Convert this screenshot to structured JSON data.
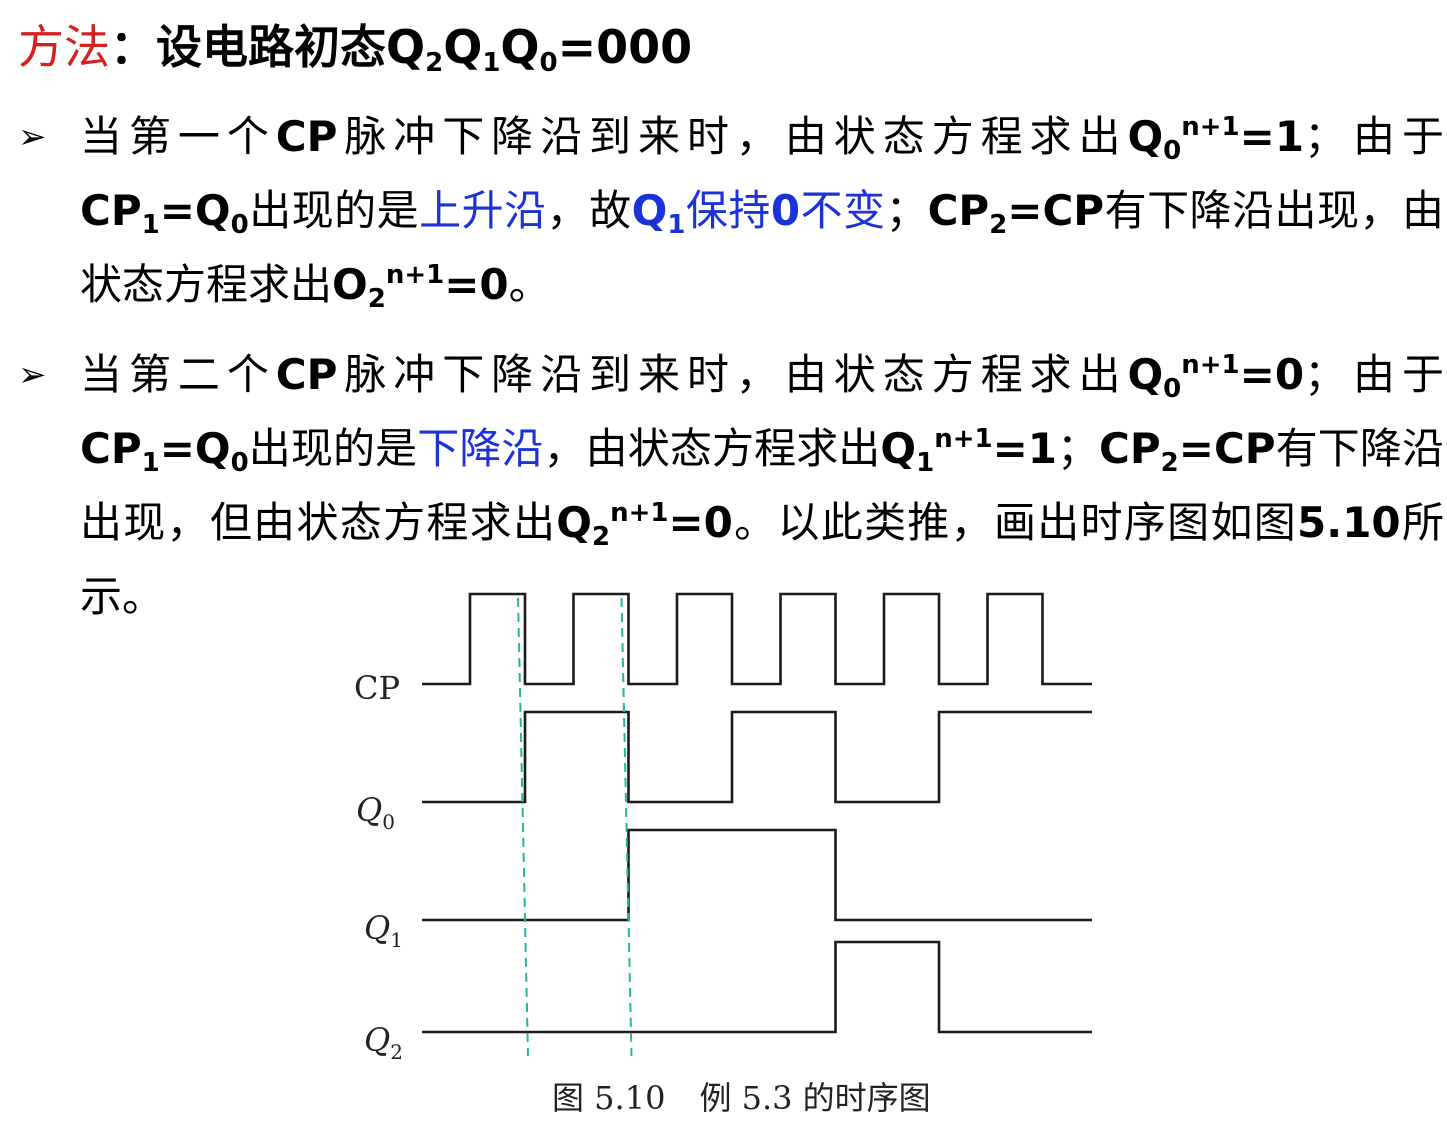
{
  "title": {
    "lead": "方法",
    "colon": "：",
    "text": "设电路初态Q",
    "sub2": "2",
    "q1": "Q",
    "sub1": "1",
    "q0": "Q",
    "sub0": "0",
    "tail": "=000"
  },
  "bullet1": {
    "arrow": "➢",
    "p1": "当第一个",
    "cp": "CP",
    "p2": "脉冲下降沿到来时，由状态方程求出",
    "q0": "Q",
    "q0sub": "0",
    "q0sup": "n+1",
    "q0val": "=1",
    "p3": "；由于",
    "cp1": "CP",
    "cp1sub": "1",
    "eq": "=Q",
    "eqsub": "0",
    "p4": "出现的是",
    "rise": "上升沿",
    "p5": "，故",
    "keep_q": "Q",
    "keep_sub": "1",
    "keep_text": "保持",
    "keep_zero": "0",
    "keep_tail": "不变",
    "p6": "；",
    "cp2": "CP",
    "cp2sub": "2",
    "cp2eq": "=CP",
    "p7": "有下降沿出现，由状态方程求出",
    "o2": "O",
    "o2sub": "2",
    "o2sup": "n+1",
    "o2val": "=0",
    "p8": "。"
  },
  "bullet2": {
    "arrow": "➢",
    "p1": "当第二个",
    "cp": "CP",
    "p2": "脉冲下降沿到来时，由状态方程求出",
    "q0": "Q",
    "q0sub": "0",
    "q0sup": "n+1",
    "q0val": "=0",
    "p3": "；由于",
    "cp1": "CP",
    "cp1sub": "1",
    "eq": "=Q",
    "eqsub": "0",
    "p4": "出现的是",
    "fall": "下降沿",
    "p5": "，由状态方程求出",
    "q1": "Q",
    "q1sub": "1",
    "q1sup": "n+1",
    "q1val": "=1",
    "p6": "；",
    "cp2": "CP",
    "cp2sub": "2",
    "cp2eq": "=CP",
    "p7": "有下降沿出现，但由状态方程求出",
    "q2": "Q",
    "q2sub": "2",
    "q2sup": "n+1",
    "q2val": "=0",
    "p8": "。以此类推，画出时序图如图",
    "fig": "5.10",
    "p9": "所示。"
  },
  "figure": {
    "labels": {
      "cp": "CP",
      "q0": "Q",
      "q0sub": "0",
      "q1": "Q",
      "q1sub": "1",
      "q2": "Q",
      "q2sub": "2"
    },
    "caption_num": "图 5.10",
    "caption_text": "例 5.3 的时序图",
    "colors": {
      "wave": "#1a1a1a",
      "guide": "#1fb8a0"
    },
    "waveforms": {
      "cp_pulses": 6,
      "q0": [
        0,
        1,
        0,
        1,
        0,
        1
      ],
      "q1": [
        0,
        0,
        1,
        1,
        0,
        0
      ],
      "q2": [
        0,
        0,
        0,
        0,
        1,
        0
      ]
    }
  }
}
